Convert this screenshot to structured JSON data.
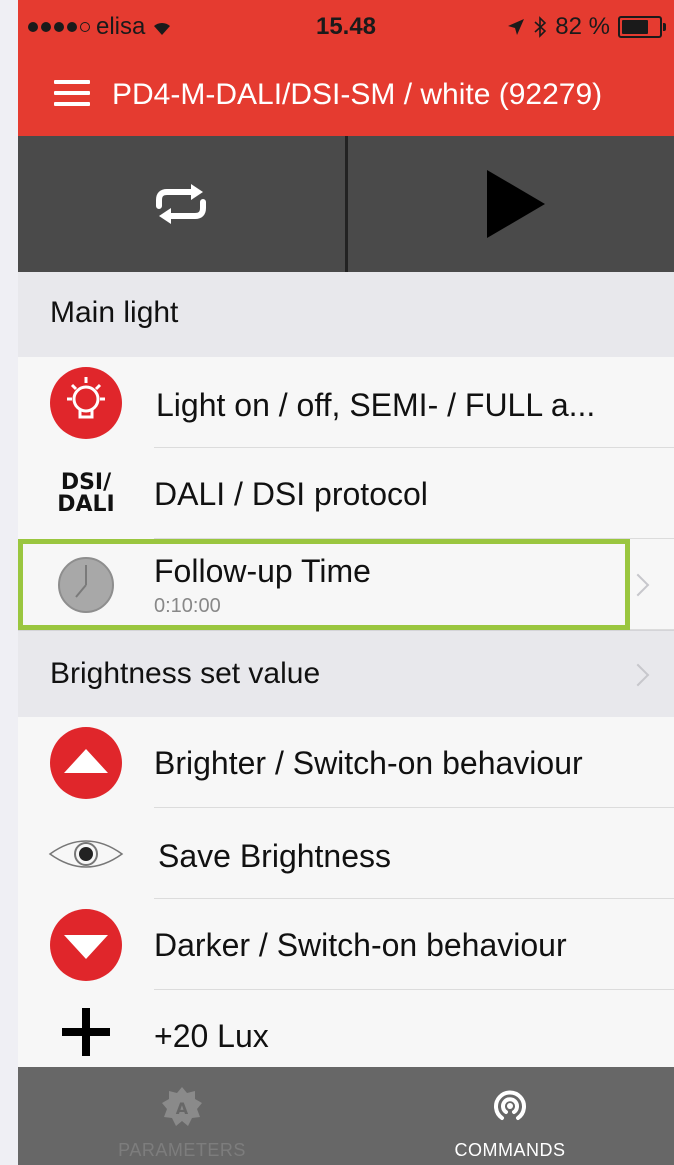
{
  "status_bar": {
    "carrier": "elisa",
    "time": "15.48",
    "battery": "82 %",
    "battery_level": 0.82
  },
  "nav": {
    "title": "PD4-M-DALI/DSI-SM / white  (92279)"
  },
  "toolbar": {
    "repeat_icon": "repeat-icon",
    "play_icon": "play-icon"
  },
  "sections": [
    {
      "title": "Main light",
      "rows": [
        {
          "label": "Light on / off, SEMI- / FULL a...",
          "icon": "light-bulb-icon"
        },
        {
          "label": "DALI / DSI protocol",
          "icon": "dsi-dali-icon",
          "icon_text": [
            "DSI/",
            "DALI"
          ]
        },
        {
          "label": "Follow-up Time",
          "sub": "0:10:00",
          "icon": "clock-icon",
          "highlighted": true
        }
      ]
    },
    {
      "title": "Brightness set value",
      "rows": [
        {
          "label": "Brighter / Switch-on behaviour",
          "icon": "brighter-arrow-icon"
        },
        {
          "label": "Save Brightness",
          "icon": "eye-icon"
        },
        {
          "label": "Darker / Switch-on behaviour",
          "icon": "darker-arrow-icon"
        },
        {
          "label": "+20 Lux",
          "icon": "plus-icon"
        }
      ]
    }
  ],
  "tabs": [
    {
      "label": "PARAMETERS",
      "icon": "parameters-gear-icon",
      "active": false
    },
    {
      "label": "COMMANDS",
      "icon": "commands-signal-icon",
      "active": true
    }
  ],
  "colors": {
    "accent": "#e53b30",
    "highlight": "#9ac63f",
    "tabbar": "#676767",
    "toolbar": "#4a4a4a"
  }
}
